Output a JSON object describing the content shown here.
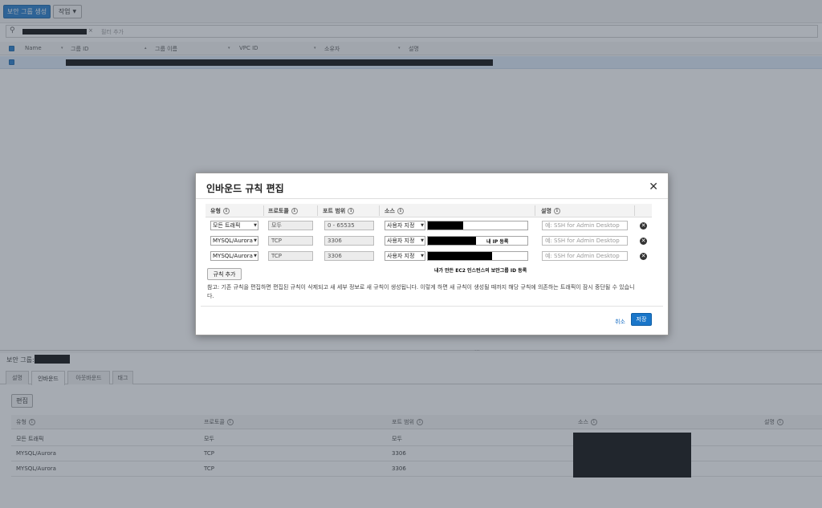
{
  "toolbar": {
    "create_label": "보안 그룹 생성",
    "actions_label": "작업"
  },
  "filter": {
    "placeholder": "필터 추가"
  },
  "grid": {
    "columns": [
      "Name",
      "그룹 ID",
      "그룹 이름",
      "VPC ID",
      "소유자",
      "설명"
    ]
  },
  "detail": {
    "label": "보안 그룹:",
    "tabs": [
      "설명",
      "인바운드",
      "아웃바운드",
      "태그"
    ],
    "active_tab": "인바운드",
    "edit_label": "편집",
    "columns": [
      "유형",
      "프로토콜",
      "포트 범위",
      "소스",
      "설명"
    ],
    "rows": [
      {
        "type": "모든 트래픽",
        "protocol": "모두",
        "port": "모두"
      },
      {
        "type": "MYSQL/Aurora",
        "protocol": "TCP",
        "port": "3306"
      },
      {
        "type": "MYSQL/Aurora",
        "protocol": "TCP",
        "port": "3306"
      }
    ]
  },
  "modal": {
    "title": "인바운드 규칙 편집",
    "columns": [
      "유형",
      "프로토콜",
      "포트 범위",
      "소스",
      "설명"
    ],
    "rules": [
      {
        "type": "모든 트래픽",
        "protocol": "모두",
        "port": "0 - 65535",
        "source_mode": "사용자 지정",
        "description_placeholder": "예: SSH for Admin Desktop",
        "annotation": ""
      },
      {
        "type": "MYSQL/Aurora",
        "protocol": "TCP",
        "port": "3306",
        "source_mode": "사용자 지정",
        "description_placeholder": "예: SSH for Admin Desktop",
        "annotation": "내 IP 등록"
      },
      {
        "type": "MYSQL/Aurora",
        "protocol": "TCP",
        "port": "3306",
        "source_mode": "사용자 지정",
        "description_placeholder": "예: SSH for Admin Desktop",
        "annotation": "내가 만든 EC2 인스턴스의 보안그룹 ID 등록"
      }
    ],
    "add_rule_label": "규칙 추가",
    "note": "참고: 기존 규칙을 편집하면 편집된 규칙이 삭제되고 새 세부 정보로 새 규칙이 생성됩니다. 이렇게 하면 새 규칙이 생성될 때까지 해당 규칙에 의존하는 트래픽이 잠시 중단될 수 있습니다.",
    "cancel_label": "취소",
    "save_label": "저장"
  }
}
